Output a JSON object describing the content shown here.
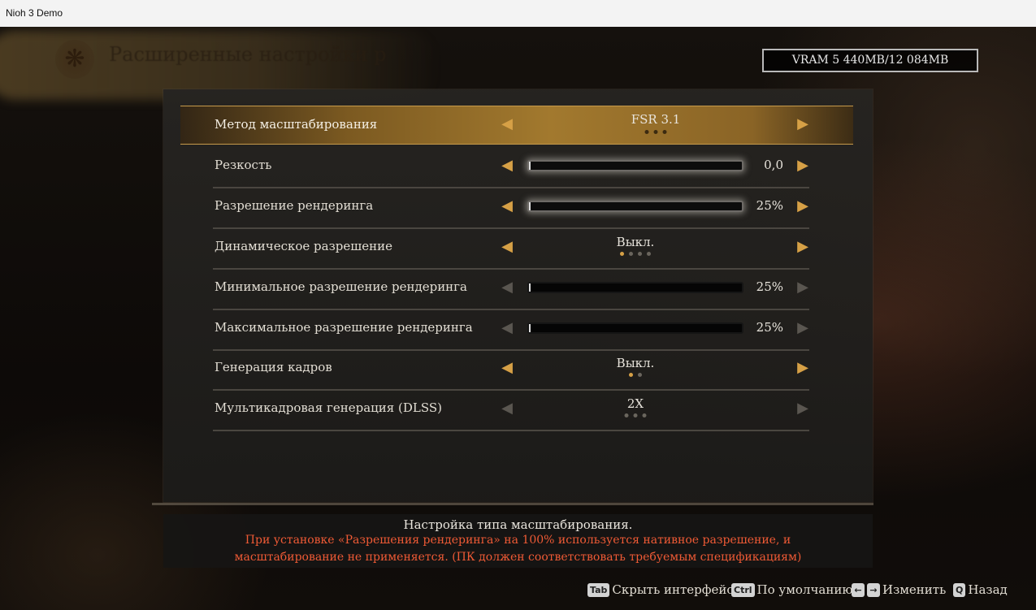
{
  "window": {
    "title": "Nioh 3 Demo"
  },
  "header": {
    "title": "Расширенные настройки р",
    "emblem": "❋"
  },
  "vram": "VRAM 5 440MB/12 084MB",
  "settings": [
    {
      "label": "Метод масштабирования",
      "value": "FSR 3.1",
      "kind": "choice",
      "selected": true,
      "enabled": true,
      "dots": 3,
      "active_dot": -1
    },
    {
      "label": "Резкость",
      "value": "0,0",
      "kind": "slider",
      "level": 0.0,
      "enabled": true
    },
    {
      "label": "Разрешение рендеринга",
      "value": "25%",
      "kind": "slider",
      "level": 0.0,
      "enabled": true
    },
    {
      "label": "Динамическое разрешение",
      "value": "Выкл.",
      "kind": "choice",
      "enabled": true,
      "dots": 4,
      "active_dot": 0
    },
    {
      "label": "Минимальное разрешение рендеринга",
      "value": "25%",
      "kind": "slider",
      "level": 0.0,
      "enabled": false
    },
    {
      "label": "Максимальное разрешение рендеринга",
      "value": "25%",
      "kind": "slider",
      "level": 0.0,
      "enabled": false
    },
    {
      "label": "Генерация кадров",
      "value": "Выкл.",
      "kind": "choice",
      "enabled": true,
      "dots": 2,
      "active_dot": 0
    },
    {
      "label": "Мультикадровая генерация (DLSS)",
      "value": "2X",
      "kind": "choice",
      "enabled": false,
      "dots": 3,
      "active_dot": -1
    }
  ],
  "help": {
    "description": "Настройка типа масштабирования.",
    "warning_line1": "При установке «Разрешения рендеринга» на 100% используется нативное разрешение, и",
    "warning_line2": "масштабирование не применяется. (ПК должен соответствовать требуемым спецификациям)"
  },
  "footer": {
    "hide": {
      "key": "Tab",
      "label": "Скрыть интерфейс"
    },
    "default": {
      "key": "Ctrl",
      "label": "По умолчанию"
    },
    "change": {
      "key_left": "←",
      "key_right": "→",
      "label": "Изменить"
    },
    "back": {
      "key": "Q",
      "label": "Назад"
    }
  },
  "colors": {
    "accent": "#d6a046",
    "warning": "#ef5a35",
    "selected_bar": "#a2792e"
  },
  "icons": {
    "left": "chevron-left-icon",
    "right": "chevron-right-icon"
  }
}
